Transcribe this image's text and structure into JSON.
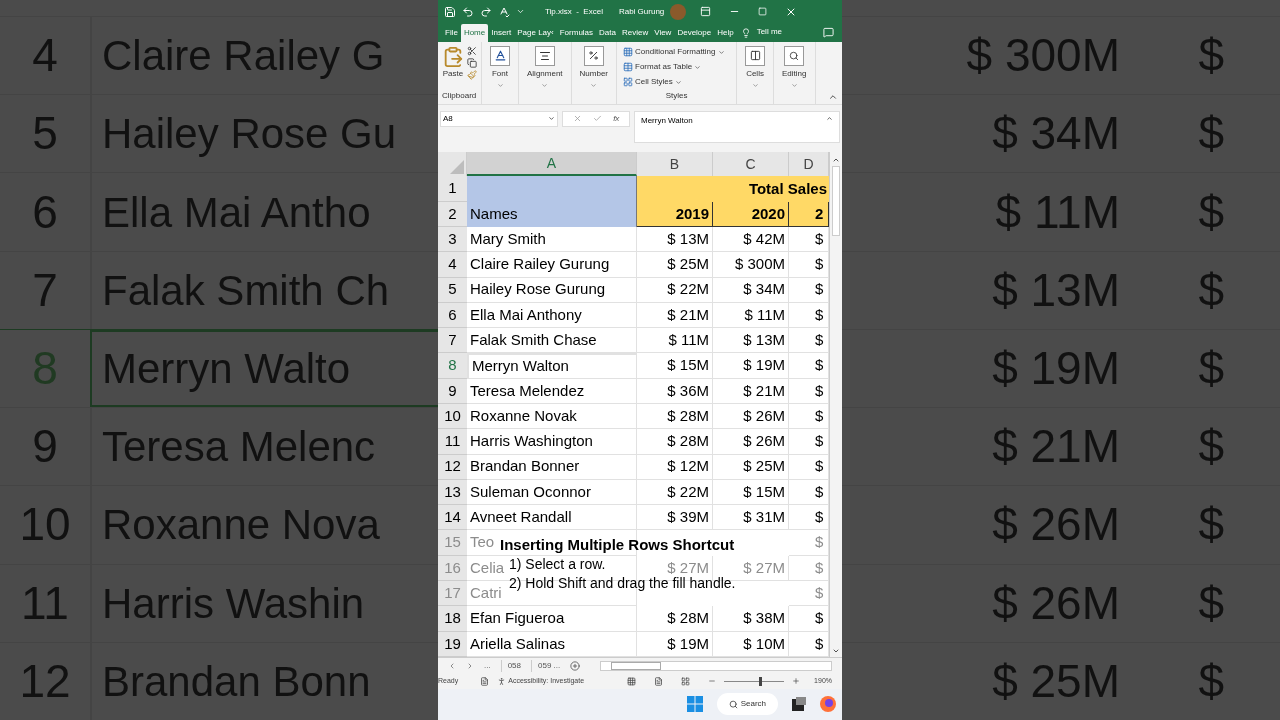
{
  "backdrop_left": {
    "rows": [
      {
        "number": "4",
        "name": "Claire Railey G",
        "selected": false
      },
      {
        "number": "5",
        "name": "Hailey Rose Gu",
        "selected": false
      },
      {
        "number": "6",
        "name": "Ella Mai Antho",
        "selected": false
      },
      {
        "number": "7",
        "name": "Falak Smith Ch",
        "selected": false
      },
      {
        "number": "8",
        "name": "Merryn Walto",
        "selected": true
      },
      {
        "number": "9",
        "name": "Teresa Melenc",
        "selected": false
      },
      {
        "number": "10",
        "name": "Roxanne Nova",
        "selected": false
      },
      {
        "number": "11",
        "name": "Harris Washin",
        "selected": false
      },
      {
        "number": "12",
        "name": "Brandan Bonn",
        "selected": false
      }
    ]
  },
  "backdrop_right": {
    "rows": [
      {
        "value": "$ 300M",
        "column_2": "$"
      },
      {
        "value": "$ 34M",
        "column_2": "$"
      },
      {
        "value": "$ 11M",
        "column_2": "$"
      },
      {
        "value": "$ 13M",
        "column_2": "$"
      },
      {
        "value": "$ 19M",
        "column_2": "$"
      },
      {
        "value": "$ 21M",
        "column_2": "$"
      },
      {
        "value": "$ 26M",
        "column_2": "$"
      },
      {
        "value": "$ 26M",
        "column_2": "$"
      },
      {
        "value": "$ 25M",
        "column_2": "$"
      }
    ]
  },
  "window": {
    "title": "Tip.xlsx  -  Excel",
    "user": "Rabi Gurung"
  },
  "ribbon_tabs": [
    {
      "label": "File",
      "selected": false
    },
    {
      "label": "Home",
      "selected": true
    },
    {
      "label": "Insert",
      "selected": false
    },
    {
      "label": "Page Lay‹",
      "selected": false
    },
    {
      "label": "Formulas",
      "selected": false
    },
    {
      "label": "Data",
      "selected": false
    },
    {
      "label": "Review",
      "selected": false
    },
    {
      "label": "View",
      "selected": false
    },
    {
      "label": "Develope",
      "selected": false
    },
    {
      "label": "Help",
      "selected": false
    }
  ],
  "tell_me": "Tell me",
  "ribbon": {
    "paste": "Paste",
    "clipboard_label": "Clipboard",
    "font": "Font",
    "alignment": "Alignment",
    "number": "Number",
    "styles_items": [
      "Conditional Formatting",
      "Format as Table",
      "Cell Styles"
    ],
    "styles_label": "Styles",
    "cells": "Cells",
    "editing": "Editing"
  },
  "formula_bar": {
    "name_box": "A8",
    "function_label": "fx",
    "value": "Merryn Walton"
  },
  "grid": {
    "columns": [
      {
        "label": "A",
        "selected": true
      },
      {
        "label": "B",
        "selected": false
      },
      {
        "label": "C",
        "selected": false
      },
      {
        "label": "D",
        "selected": false
      }
    ],
    "title": "Total Sales",
    "header_numbers": [
      "1",
      "2"
    ],
    "names_header": "Names",
    "years": [
      "2019",
      "2020",
      "2"
    ],
    "rows": [
      {
        "number": "3",
        "name": "Mary Smith",
        "b": "$ 13M",
        "c": "$ 42M",
        "d": "$",
        "selected": false,
        "faded": false
      },
      {
        "number": "4",
        "name": "Claire Railey Gurung",
        "b": "$ 25M",
        "c": "$ 300M",
        "d": "$",
        "selected": false,
        "faded": false
      },
      {
        "number": "5",
        "name": "Hailey Rose Gurung",
        "b": "$ 22M",
        "c": "$ 34M",
        "d": "$",
        "selected": false,
        "faded": false
      },
      {
        "number": "6",
        "name": "Ella Mai Anthony",
        "b": "$ 21M",
        "c": "$ 11M",
        "d": "$",
        "selected": false,
        "faded": false
      },
      {
        "number": "7",
        "name": "Falak Smith Chase",
        "b": "$ 11M",
        "c": "$ 13M",
        "d": "$",
        "selected": false,
        "faded": false
      },
      {
        "number": "8",
        "name": "Merryn Walton",
        "b": "$ 15M",
        "c": "$ 19M",
        "d": "$",
        "selected": true,
        "faded": false
      },
      {
        "number": "9",
        "name": "Teresa Melendez",
        "b": "$ 36M",
        "c": "$ 21M",
        "d": "$",
        "selected": false,
        "faded": false
      },
      {
        "number": "10",
        "name": "Roxanne Novak",
        "b": "$ 28M",
        "c": "$ 26M",
        "d": "$",
        "selected": false,
        "faded": false
      },
      {
        "number": "11",
        "name": "Harris Washington",
        "b": "$ 28M",
        "c": "$ 26M",
        "d": "$",
        "selected": false,
        "faded": false
      },
      {
        "number": "12",
        "name": "Brandan Bonner",
        "b": "$ 12M",
        "c": "$ 25M",
        "d": "$",
        "selected": false,
        "faded": false
      },
      {
        "number": "13",
        "name": "Suleman Oconnor",
        "b": "$ 22M",
        "c": "$ 15M",
        "d": "$",
        "selected": false,
        "faded": false
      },
      {
        "number": "14",
        "name": "Avneet Randall",
        "b": "$ 39M",
        "c": "$ 31M",
        "d": "$",
        "selected": false,
        "faded": false
      },
      {
        "number": "15",
        "name": "Teo",
        "d": "$",
        "faded": true
      },
      {
        "number": "16",
        "name": "Celia",
        "b": "$ 27M",
        "c": "$ 27M",
        "d": "$",
        "faded": true
      },
      {
        "number": "17",
        "name": "Catri",
        "d": "$",
        "faded": true
      },
      {
        "number": "18",
        "name": "Efan Figueroa",
        "b": "$ 28M",
        "c": "$ 38M",
        "d": "$",
        "selected": false,
        "faded": false
      },
      {
        "number": "19",
        "name": "Ariella Salinas",
        "b": "$ 19M",
        "c": "$ 10M",
        "d": "$",
        "selected": false,
        "faded": false
      }
    ]
  },
  "caption": {
    "title": "Inserting Multiple Rows Shortcut",
    "steps": [
      "1) Select a row.",
      "2) Hold Shift and drag the fill handle."
    ]
  },
  "sheet_tabs": {
    "more_left": "...",
    "tabs": [
      "058",
      "059 ..."
    ]
  },
  "status_bar": {
    "state": "Ready",
    "accessibility": "Accessibility: Investigate",
    "zoom": {
      "level": 0.6
    },
    "zoom_reading": "190%"
  },
  "taskbar": {
    "search": "Search"
  }
}
